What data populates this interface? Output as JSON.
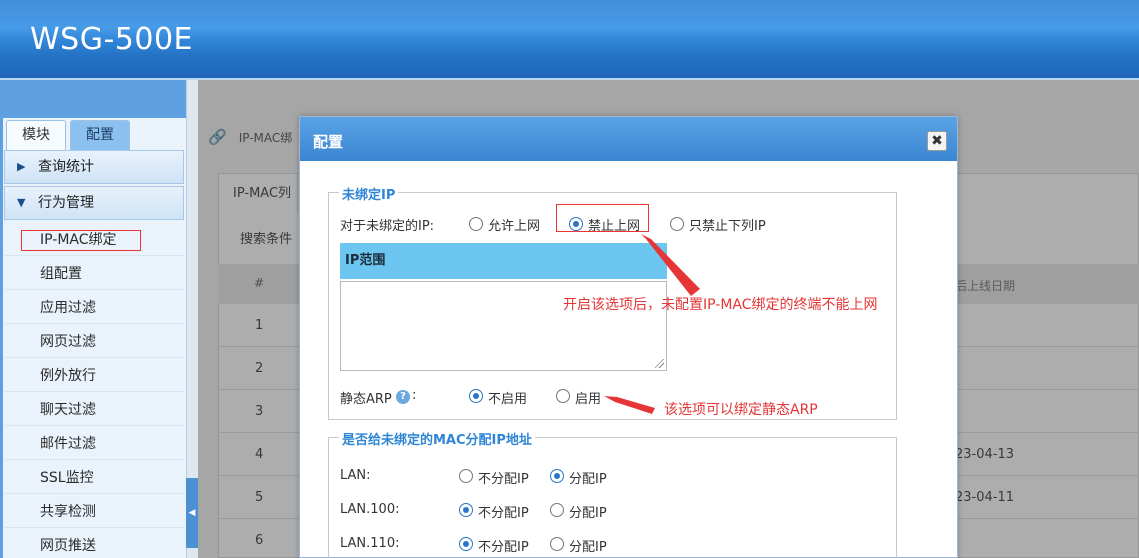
{
  "header": {
    "brand": "WSG-500E"
  },
  "sidebar": {
    "tabs": [
      "模块",
      "配置"
    ],
    "groups": [
      {
        "label": "查询统计",
        "expanded": false
      },
      {
        "label": "行为管理",
        "expanded": true
      }
    ],
    "items": [
      "IP-MAC绑定",
      "组配置",
      "应用过滤",
      "网页过滤",
      "例外放行",
      "聊天过滤",
      "邮件过滤",
      "SSL监控",
      "共享检测",
      "网页推送"
    ],
    "active_item": "IP-MAC绑定"
  },
  "background": {
    "breadcrumb": "IP-MAC绑",
    "tab_label": "IP-MAC列",
    "search_label": "搜索条件",
    "table_hash": "#",
    "last_date_header": "后上线日期",
    "rows": [
      "1",
      "2",
      "3",
      "4",
      "5",
      "6"
    ],
    "dates": [
      "",
      "",
      "",
      "23-04-13",
      "23-04-11",
      ""
    ]
  },
  "dialog": {
    "title": "配置",
    "close_icon": "close-icon",
    "unbound_ip": {
      "legend": "未绑定IP",
      "label": "对于未绑定的IP:",
      "options": [
        "允许上网",
        "禁止上网",
        "只禁止下列IP"
      ],
      "selected": "禁止上网",
      "ip_range_header": "IP范围",
      "static_arp_label": "静态ARP",
      "static_arp_suffix": ":",
      "static_arp_options": [
        "不启用",
        "启用"
      ],
      "static_arp_selected": "不启用"
    },
    "mac_assign": {
      "legend": "是否给未绑定的MAC分配IP地址",
      "option_labels": [
        "不分配IP",
        "分配IP"
      ],
      "rows": [
        {
          "name": "LAN:",
          "selected": "分配IP"
        },
        {
          "name": "LAN.100:",
          "selected": "不分配IP"
        },
        {
          "name": "LAN.110:",
          "selected": "不分配IP"
        }
      ]
    }
  },
  "annotations": {
    "note1": "开启该选项后，未配置IP-MAC绑定的终端不能上网",
    "note2": "该选项可以绑定静态ARP"
  },
  "colors": {
    "header": "#2a7fd6",
    "accent": "#2f86d6",
    "annotation": "#e53535",
    "ip_header": "#6dc6f0"
  }
}
